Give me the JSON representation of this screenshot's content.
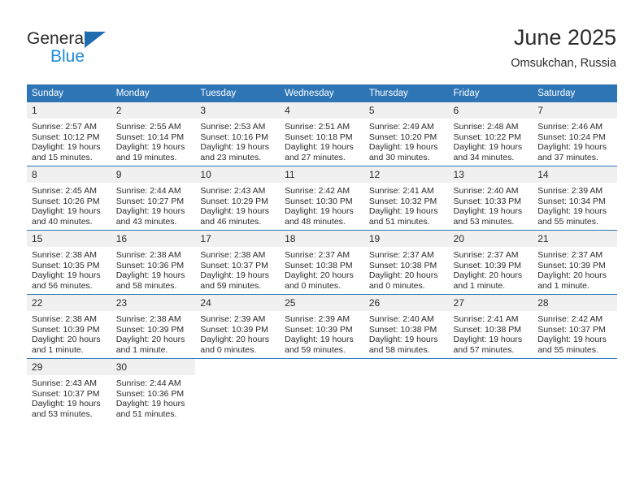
{
  "brand": {
    "name_part1": "General",
    "name_part2": "Blue",
    "triangle_icon": "triangle-right-icon",
    "color_dark": "#2b2b2b",
    "color_blue": "#1f8ad6",
    "color_triangle": "#1f6bb0"
  },
  "header": {
    "title": "June 2025",
    "subtitle": "Omsukchan, Russia"
  },
  "theme": {
    "header_bg": "#2e75b6",
    "header_text": "#ffffff",
    "daynum_bg": "#f0f0f0",
    "row_divider": "#2e75b6",
    "body_text": "#2b2b2b"
  },
  "calendar": {
    "weekday_headers": [
      "Sunday",
      "Monday",
      "Tuesday",
      "Wednesday",
      "Thursday",
      "Friday",
      "Saturday"
    ],
    "weeks": [
      [
        {
          "day": "1",
          "sunrise": "Sunrise: 2:57 AM",
          "sunset": "Sunset: 10:12 PM",
          "daylight": "Daylight: 19 hours and 15 minutes."
        },
        {
          "day": "2",
          "sunrise": "Sunrise: 2:55 AM",
          "sunset": "Sunset: 10:14 PM",
          "daylight": "Daylight: 19 hours and 19 minutes."
        },
        {
          "day": "3",
          "sunrise": "Sunrise: 2:53 AM",
          "sunset": "Sunset: 10:16 PM",
          "daylight": "Daylight: 19 hours and 23 minutes."
        },
        {
          "day": "4",
          "sunrise": "Sunrise: 2:51 AM",
          "sunset": "Sunset: 10:18 PM",
          "daylight": "Daylight: 19 hours and 27 minutes."
        },
        {
          "day": "5",
          "sunrise": "Sunrise: 2:49 AM",
          "sunset": "Sunset: 10:20 PM",
          "daylight": "Daylight: 19 hours and 30 minutes."
        },
        {
          "day": "6",
          "sunrise": "Sunrise: 2:48 AM",
          "sunset": "Sunset: 10:22 PM",
          "daylight": "Daylight: 19 hours and 34 minutes."
        },
        {
          "day": "7",
          "sunrise": "Sunrise: 2:46 AM",
          "sunset": "Sunset: 10:24 PM",
          "daylight": "Daylight: 19 hours and 37 minutes."
        }
      ],
      [
        {
          "day": "8",
          "sunrise": "Sunrise: 2:45 AM",
          "sunset": "Sunset: 10:26 PM",
          "daylight": "Daylight: 19 hours and 40 minutes."
        },
        {
          "day": "9",
          "sunrise": "Sunrise: 2:44 AM",
          "sunset": "Sunset: 10:27 PM",
          "daylight": "Daylight: 19 hours and 43 minutes."
        },
        {
          "day": "10",
          "sunrise": "Sunrise: 2:43 AM",
          "sunset": "Sunset: 10:29 PM",
          "daylight": "Daylight: 19 hours and 46 minutes."
        },
        {
          "day": "11",
          "sunrise": "Sunrise: 2:42 AM",
          "sunset": "Sunset: 10:30 PM",
          "daylight": "Daylight: 19 hours and 48 minutes."
        },
        {
          "day": "12",
          "sunrise": "Sunrise: 2:41 AM",
          "sunset": "Sunset: 10:32 PM",
          "daylight": "Daylight: 19 hours and 51 minutes."
        },
        {
          "day": "13",
          "sunrise": "Sunrise: 2:40 AM",
          "sunset": "Sunset: 10:33 PM",
          "daylight": "Daylight: 19 hours and 53 minutes."
        },
        {
          "day": "14",
          "sunrise": "Sunrise: 2:39 AM",
          "sunset": "Sunset: 10:34 PM",
          "daylight": "Daylight: 19 hours and 55 minutes."
        }
      ],
      [
        {
          "day": "15",
          "sunrise": "Sunrise: 2:38 AM",
          "sunset": "Sunset: 10:35 PM",
          "daylight": "Daylight: 19 hours and 56 minutes."
        },
        {
          "day": "16",
          "sunrise": "Sunrise: 2:38 AM",
          "sunset": "Sunset: 10:36 PM",
          "daylight": "Daylight: 19 hours and 58 minutes."
        },
        {
          "day": "17",
          "sunrise": "Sunrise: 2:38 AM",
          "sunset": "Sunset: 10:37 PM",
          "daylight": "Daylight: 19 hours and 59 minutes."
        },
        {
          "day": "18",
          "sunrise": "Sunrise: 2:37 AM",
          "sunset": "Sunset: 10:38 PM",
          "daylight": "Daylight: 20 hours and 0 minutes."
        },
        {
          "day": "19",
          "sunrise": "Sunrise: 2:37 AM",
          "sunset": "Sunset: 10:38 PM",
          "daylight": "Daylight: 20 hours and 0 minutes."
        },
        {
          "day": "20",
          "sunrise": "Sunrise: 2:37 AM",
          "sunset": "Sunset: 10:39 PM",
          "daylight": "Daylight: 20 hours and 1 minute."
        },
        {
          "day": "21",
          "sunrise": "Sunrise: 2:37 AM",
          "sunset": "Sunset: 10:39 PM",
          "daylight": "Daylight: 20 hours and 1 minute."
        }
      ],
      [
        {
          "day": "22",
          "sunrise": "Sunrise: 2:38 AM",
          "sunset": "Sunset: 10:39 PM",
          "daylight": "Daylight: 20 hours and 1 minute."
        },
        {
          "day": "23",
          "sunrise": "Sunrise: 2:38 AM",
          "sunset": "Sunset: 10:39 PM",
          "daylight": "Daylight: 20 hours and 1 minute."
        },
        {
          "day": "24",
          "sunrise": "Sunrise: 2:39 AM",
          "sunset": "Sunset: 10:39 PM",
          "daylight": "Daylight: 20 hours and 0 minutes."
        },
        {
          "day": "25",
          "sunrise": "Sunrise: 2:39 AM",
          "sunset": "Sunset: 10:39 PM",
          "daylight": "Daylight: 19 hours and 59 minutes."
        },
        {
          "day": "26",
          "sunrise": "Sunrise: 2:40 AM",
          "sunset": "Sunset: 10:38 PM",
          "daylight": "Daylight: 19 hours and 58 minutes."
        },
        {
          "day": "27",
          "sunrise": "Sunrise: 2:41 AM",
          "sunset": "Sunset: 10:38 PM",
          "daylight": "Daylight: 19 hours and 57 minutes."
        },
        {
          "day": "28",
          "sunrise": "Sunrise: 2:42 AM",
          "sunset": "Sunset: 10:37 PM",
          "daylight": "Daylight: 19 hours and 55 minutes."
        }
      ],
      [
        {
          "day": "29",
          "sunrise": "Sunrise: 2:43 AM",
          "sunset": "Sunset: 10:37 PM",
          "daylight": "Daylight: 19 hours and 53 minutes."
        },
        {
          "day": "30",
          "sunrise": "Sunrise: 2:44 AM",
          "sunset": "Sunset: 10:36 PM",
          "daylight": "Daylight: 19 hours and 51 minutes."
        },
        {
          "day": "",
          "sunrise": "",
          "sunset": "",
          "daylight": ""
        },
        {
          "day": "",
          "sunrise": "",
          "sunset": "",
          "daylight": ""
        },
        {
          "day": "",
          "sunrise": "",
          "sunset": "",
          "daylight": ""
        },
        {
          "day": "",
          "sunrise": "",
          "sunset": "",
          "daylight": ""
        },
        {
          "day": "",
          "sunrise": "",
          "sunset": "",
          "daylight": ""
        }
      ]
    ]
  }
}
